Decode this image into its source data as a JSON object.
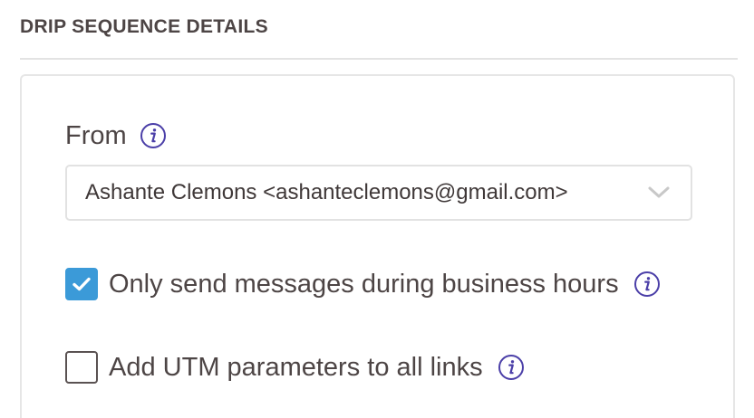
{
  "section": {
    "title": "DRIP SEQUENCE DETAILS"
  },
  "from": {
    "label": "From",
    "info_icon": "info-icon",
    "selected_value": "Ashante Clemons <ashanteclemons@gmail.com>",
    "chevron_icon": "chevron-down-icon"
  },
  "options": [
    {
      "label": "Only send messages during business hours",
      "checked": true,
      "info_icon": "info-icon"
    },
    {
      "label": "Add UTM parameters to all links",
      "checked": false,
      "info_icon": "info-icon"
    }
  ],
  "colors": {
    "accent": "#3b9ad8",
    "info_icon": "#4b3fa8",
    "text": "#4d4545",
    "border": "#e2e2e2"
  }
}
